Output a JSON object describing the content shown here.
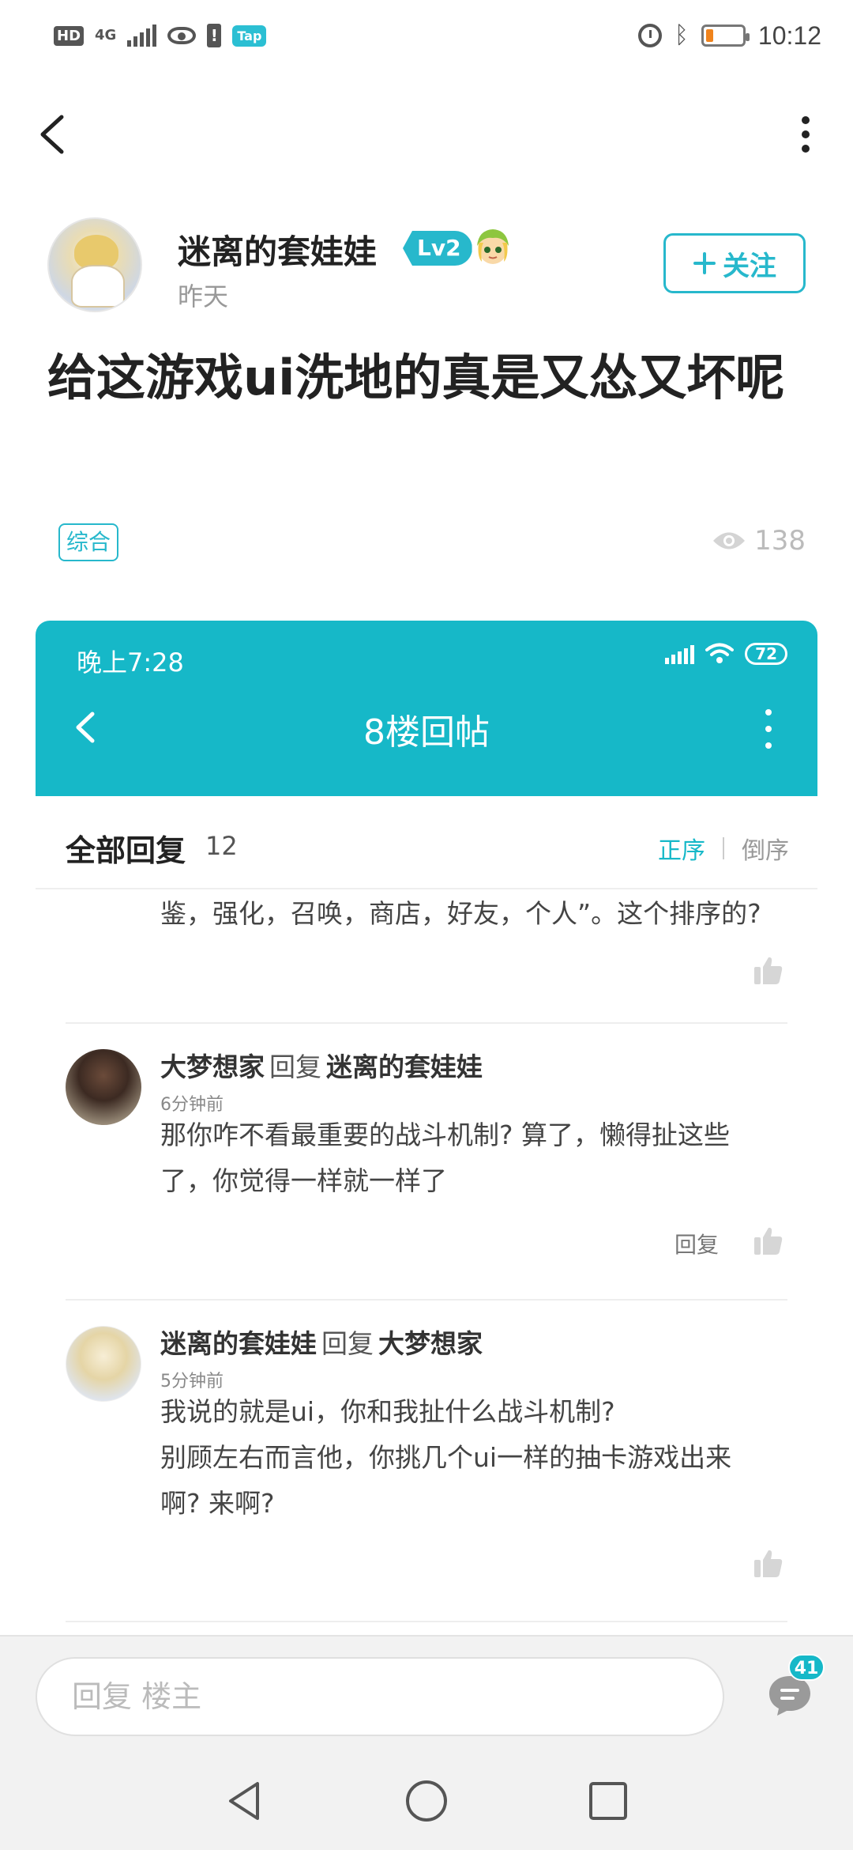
{
  "status_bar": {
    "hd": "HD",
    "network": "4G",
    "tap_label": "Tap",
    "time": "10:12",
    "battery_level": 0.2
  },
  "post": {
    "author_name": "迷离的套娃娃",
    "level": "Lv2",
    "posted_time": "昨天",
    "follow_label": "关注",
    "title": "给这游戏ui洗地的真是又怂又坏呢",
    "tag": "综合",
    "views": "138"
  },
  "screenshot": {
    "status_time": "晚上7:28",
    "battery": "72",
    "title": "8楼回帖",
    "replies_label": "全部回复",
    "replies_count": "12",
    "sort_asc": "正序",
    "sort_desc": "倒序",
    "fragment": "鉴，强化，召唤，商店，好友，个人”。这个排序的?",
    "comments": [
      {
        "author": "大梦想家",
        "reply_word": "回复",
        "reply_to": "迷离的套娃娃",
        "time": "6分钟前",
        "lines": [
          "那你咋不看最重要的战斗机制? 算了，懒得扯这些",
          "了，你觉得一样就一样了"
        ],
        "reply_label": "回复"
      },
      {
        "author": "迷离的套娃娃",
        "reply_word": "回复",
        "reply_to": "大梦想家",
        "time": "5分钟前",
        "lines": [
          "我说的就是ui，你和我扯什么战斗机制?",
          "别顾左右而言他，你挑几个ui一样的抽卡游戏出来",
          "啊? 来啊?"
        ]
      }
    ]
  },
  "bottom_bar": {
    "input_placeholder": "回复  楼主",
    "comment_badge": "41"
  },
  "colors": {
    "accent": "#27b8cc",
    "header_teal": "#16b8c8",
    "battery_orange": "#f0831c"
  },
  "icons": [
    "back-arrow-icon",
    "more-vert-icon",
    "plus-icon",
    "eye-icon",
    "like-icon",
    "chat-icon",
    "nav-back-icon",
    "nav-home-icon",
    "nav-recents-icon"
  ]
}
